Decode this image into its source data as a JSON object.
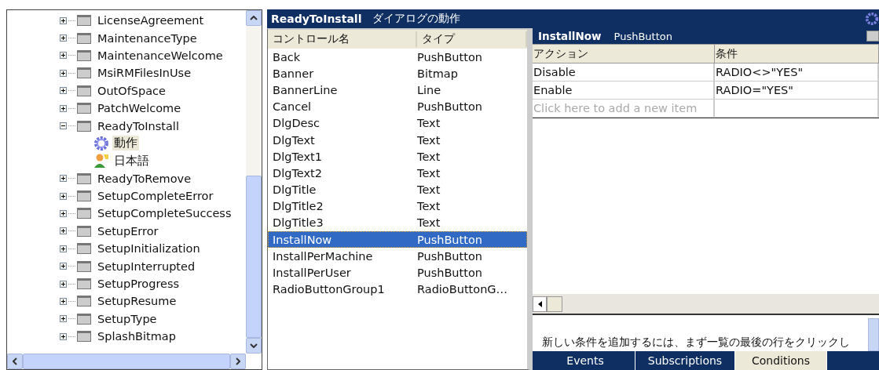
{
  "tree": {
    "items": [
      {
        "label": "LicenseAgreement",
        "expanded": false
      },
      {
        "label": "MaintenanceType",
        "expanded": false
      },
      {
        "label": "MaintenanceWelcome",
        "expanded": false
      },
      {
        "label": "MsiRMFilesInUse",
        "expanded": false
      },
      {
        "label": "OutOfSpace",
        "expanded": false
      },
      {
        "label": "PatchWelcome",
        "expanded": false
      },
      {
        "label": "ReadyToInstall",
        "expanded": true,
        "children": [
          {
            "label": "動作",
            "kind": "behavior",
            "selected": true
          },
          {
            "label": "日本語",
            "kind": "language",
            "selected": false
          }
        ]
      },
      {
        "label": "ReadyToRemove",
        "expanded": false
      },
      {
        "label": "SetupCompleteError",
        "expanded": false
      },
      {
        "label": "SetupCompleteSuccess",
        "expanded": false
      },
      {
        "label": "SetupError",
        "expanded": false
      },
      {
        "label": "SetupInitialization",
        "expanded": false
      },
      {
        "label": "SetupInterrupted",
        "expanded": false
      },
      {
        "label": "SetupProgress",
        "expanded": false
      },
      {
        "label": "SetupResume",
        "expanded": false
      },
      {
        "label": "SetupType",
        "expanded": false
      },
      {
        "label": "SplashBitmap",
        "expanded": false
      }
    ]
  },
  "title_bar": {
    "name": "ReadyToInstall",
    "subtitle": "ダイアログの動作"
  },
  "controls": {
    "columns": [
      "コントロール名",
      "タイプ"
    ],
    "rows": [
      {
        "name": "Back",
        "type": "PushButton",
        "selected": false
      },
      {
        "name": "Banner",
        "type": "Bitmap",
        "selected": false
      },
      {
        "name": "BannerLine",
        "type": "Line",
        "selected": false
      },
      {
        "name": "Cancel",
        "type": "PushButton",
        "selected": false
      },
      {
        "name": "DlgDesc",
        "type": "Text",
        "selected": false
      },
      {
        "name": "DlgText",
        "type": "Text",
        "selected": false
      },
      {
        "name": "DlgText1",
        "type": "Text",
        "selected": false
      },
      {
        "name": "DlgText2",
        "type": "Text",
        "selected": false
      },
      {
        "name": "DlgTitle",
        "type": "Text",
        "selected": false
      },
      {
        "name": "DlgTitle2",
        "type": "Text",
        "selected": false
      },
      {
        "name": "DlgTitle3",
        "type": "Text",
        "selected": false
      },
      {
        "name": "InstallNow",
        "type": "PushButton",
        "selected": true
      },
      {
        "name": "InstallPerMachine",
        "type": "PushButton",
        "selected": false
      },
      {
        "name": "InstallPerUser",
        "type": "PushButton",
        "selected": false
      },
      {
        "name": "RadioButtonGroup1",
        "type": "RadioButtonG…",
        "selected": false
      }
    ]
  },
  "detail": {
    "control": "InstallNow",
    "type": "PushButton",
    "columns": [
      "アクション",
      "条件"
    ],
    "rows": [
      {
        "action": "Disable",
        "condition": "RADIO<>\"YES\""
      },
      {
        "action": "Enable",
        "condition": "RADIO=\"YES\""
      }
    ],
    "new_item_placeholder": "Click here to add a new item",
    "description": "新しい条件を追加するには、まず一覧の最後の行をクリックし"
  },
  "tabs": [
    {
      "label": "Events",
      "selected": false
    },
    {
      "label": "Subscriptions",
      "selected": false
    },
    {
      "label": "Conditions",
      "selected": true
    }
  ]
}
